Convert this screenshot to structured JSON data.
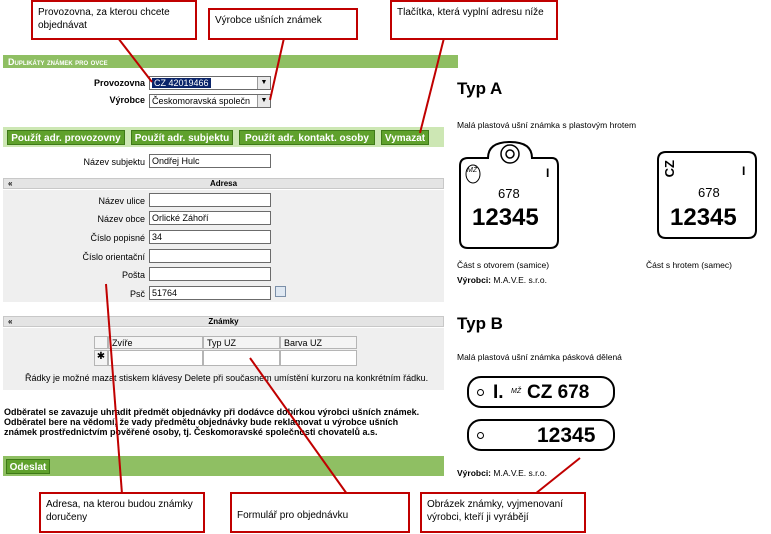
{
  "callouts": {
    "provozovna": "Provozovna, za kterou chcete objednávat",
    "vyrobce": "Výrobce ušních známek",
    "tlacitka": "Tlačítka, která vyplní adresu níže",
    "adresa": "Adresa, na kterou budou známky doručeny",
    "formular": "Formulář pro objednávku",
    "obrazek": "Obrázek známky, vyjmenovaní výrobci, kteří ji vyrábějí"
  },
  "header": {
    "title": "Duplikáty známek pro ovce"
  },
  "form": {
    "provozovna_label": "Provozovna",
    "provozovna_value": "CZ 42019466",
    "vyrobce_label": "Výrobce",
    "vyrobce_value": "Českomoravská společn"
  },
  "buttons": {
    "adr_provozovny": "Použít adr. provozovny",
    "adr_subjektu": "Použít adr. subjektu",
    "adr_kontakt": "Použít adr. kontakt. osoby",
    "vymazat": "Vymazat"
  },
  "subject": {
    "label": "Název subjektu",
    "value": "Ondřej Hulc"
  },
  "address": {
    "section_title": "Adresa",
    "fields": [
      {
        "label": "Název ulice",
        "value": ""
      },
      {
        "label": "Název obce",
        "value": "Orlické Záhoří"
      },
      {
        "label": "Číslo popisné",
        "value": "34"
      },
      {
        "label": "Číslo orientační",
        "value": ""
      },
      {
        "label": "Pošta",
        "value": ""
      },
      {
        "label": "Psč",
        "value": "51764"
      }
    ]
  },
  "known": {
    "section_title": "Známky",
    "columns": [
      "Zvíře",
      "Typ UZ",
      "Barva UZ"
    ],
    "new_row_marker": "✱",
    "hint": "Řádky je možné mazat stiskem klávesy Delete při současném umístění kurzoru na konkrétním řádku."
  },
  "disclaimer": [
    "Odběratel se zavazuje uhradit předmět objednávky při dodávce dobírkou výrobci ušních známek.",
    "Odběratel bere na vědomí, že vady předmětu objednávky bude reklamovat u výrobce ušních",
    "známek prostřednictvím pověřené osoby, tj. Českomoravské společnosti chovatelů a.s."
  ],
  "submit_label": "Odeslat",
  "typeA": {
    "title": "Typ A",
    "desc": "Malá plastová ušní známka s plastovým hrotem",
    "tag1": {
      "small": "678",
      "big": "12345",
      "logo": "MŽ",
      "mark": "I"
    },
    "tag2": {
      "cz": "CZ",
      "small": "678",
      "big": "12345",
      "mark": "I"
    },
    "caption1": "Část s otvorem (samice)",
    "caption2": "Část s hrotem (samec)",
    "vyrobci_label": "Výrobci:",
    "vyrobci_value": "M.A.V.E. s.r.o."
  },
  "typeB": {
    "title": "Typ B",
    "desc": "Malá plastová ušní známka pásková dělená",
    "tag1": {
      "mark": "I.",
      "logo": "MŽ",
      "text": "CZ 678"
    },
    "tag2": {
      "big": "12345"
    },
    "vyrobci_label": "Výrobci:",
    "vyrobci_value": "M.A.V.E. s.r.o."
  },
  "colors": {
    "green_bar": "#8fbf63",
    "button": "#5fa12c",
    "callout_border": "#c00000"
  }
}
